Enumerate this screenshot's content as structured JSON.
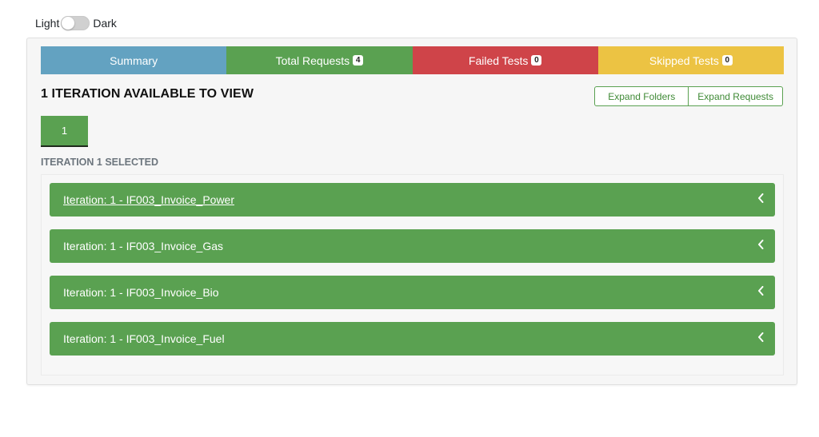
{
  "theme": {
    "light_label": "Light",
    "dark_label": "Dark"
  },
  "tabs": [
    {
      "label": "Summary",
      "badge": null,
      "color": "#63a2c1"
    },
    {
      "label": "Total Requests",
      "badge": "4",
      "color": "#5aa151"
    },
    {
      "label": "Failed Tests",
      "badge": "0",
      "color": "#cf4449"
    },
    {
      "label": "Skipped Tests",
      "badge": "0",
      "color": "#ecc343"
    }
  ],
  "iterations": {
    "heading": "1 ITERATION AVAILABLE TO VIEW",
    "expand_folders": "Expand Folders",
    "expand_requests": "Expand Requests",
    "pill": "1",
    "selected_label": "ITERATION 1 SELECTED"
  },
  "items": [
    {
      "title": "Iteration: 1 - IF003_Invoice_Power",
      "icon": "chevron-left-icon"
    },
    {
      "title": "Iteration: 1 - IF003_Invoice_Gas",
      "icon": "chevron-left-icon"
    },
    {
      "title": "Iteration: 1 - IF003_Invoice_Bio",
      "icon": "chevron-left-icon"
    },
    {
      "title": "Iteration: 1 - IF003_Invoice_Fuel",
      "icon": "chevron-left-icon"
    }
  ],
  "colors": {
    "accent_green": "#5aa151"
  }
}
